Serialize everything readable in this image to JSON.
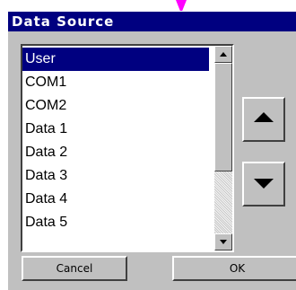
{
  "dialog": {
    "title": "Data Source"
  },
  "list": {
    "items": [
      {
        "label": "User",
        "selected": true
      },
      {
        "label": "COM1",
        "selected": false
      },
      {
        "label": "COM2",
        "selected": false
      },
      {
        "label": "Data 1",
        "selected": false
      },
      {
        "label": "Data 2",
        "selected": false
      },
      {
        "label": "Data 3",
        "selected": false
      },
      {
        "label": "Data 4",
        "selected": false
      },
      {
        "label": "Data 5",
        "selected": false
      }
    ]
  },
  "buttons": {
    "cancel_label": "Cancel",
    "ok_label": "OK"
  },
  "icons": {
    "move_up": "triangle-up-icon",
    "move_down": "triangle-down-icon",
    "pointer": "pointer-arrow-icon"
  },
  "colors": {
    "title_bg": "#000080",
    "selection_bg": "#000080",
    "face": "#c0c0c0",
    "pointer": "#ff00ff"
  }
}
